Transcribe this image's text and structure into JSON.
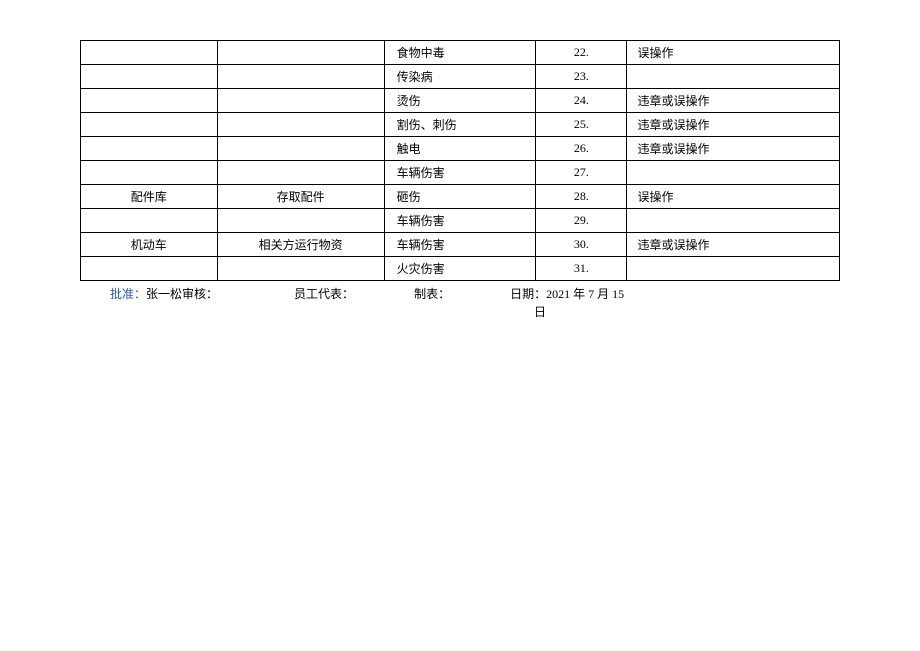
{
  "table": {
    "rows": [
      {
        "c1": "",
        "c2": "",
        "c3": "食物中毒",
        "c4": "22.",
        "c5": "误操作"
      },
      {
        "c1": "",
        "c2": "",
        "c3": "传染病",
        "c4": "23.",
        "c5": ""
      },
      {
        "c1": "",
        "c2": "",
        "c3": "烫伤",
        "c4": "24.",
        "c5": "违章或误操作"
      },
      {
        "c1": "",
        "c2": "",
        "c3": "割伤、刺伤",
        "c4": "25.",
        "c5": "违章或误操作"
      },
      {
        "c1": "",
        "c2": "",
        "c3": "触电",
        "c4": "26.",
        "c5": "违章或误操作"
      },
      {
        "c1": "",
        "c2": "",
        "c3": "车辆伤害",
        "c4": "27.",
        "c5": ""
      },
      {
        "c1": "配件库",
        "c2": "存取配件",
        "c3": "砸伤",
        "c4": "28.",
        "c5": "误操作"
      },
      {
        "c1": "",
        "c2": "",
        "c3": "车辆伤害",
        "c4": "29.",
        "c5": ""
      },
      {
        "c1": "机动车",
        "c2": "相关方运行物资",
        "c3": "车辆伤害",
        "c4": "30.",
        "c5": "违章或误操作"
      },
      {
        "c1": "",
        "c2": "",
        "c3": "火灾伤害",
        "c4": "31.",
        "c5": ""
      }
    ]
  },
  "footer": {
    "approve_label": "批准：",
    "approve_value": "张一松",
    "audit_label": "审核：",
    "rep_label": "员工代表：",
    "maker_label": "制表：",
    "date_label": "日期：",
    "date_value": "2021 年 7 月 15",
    "date_day": "日"
  }
}
